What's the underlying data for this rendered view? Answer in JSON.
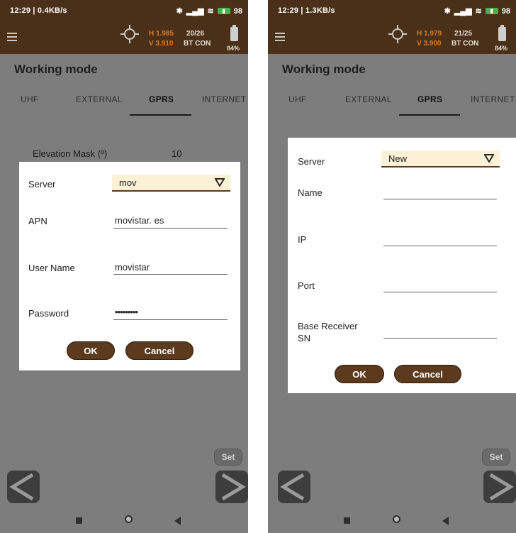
{
  "left": {
    "status": {
      "time": "12:29 | 0.4KB/s",
      "battery": "98"
    },
    "gps": {
      "h": "H 1.985",
      "v": "V 3.910",
      "sat": "20/26",
      "bt": "BT CON",
      "battery_pct": "84%"
    },
    "title": "Working mode",
    "tabs": [
      "UHF",
      "EXTERNAL",
      "GPRS",
      "INTERNET"
    ],
    "elevation": {
      "label": "Elevation Mask (º)",
      "value": "10"
    },
    "dialog": {
      "server_label": "Server",
      "server_value": "mov",
      "apn_label": "APN",
      "apn_value": "movistar. es",
      "user_label": "User Name",
      "user_value": "movistar",
      "password_label": "Password",
      "password_value": "•••••••••",
      "ok": "OK",
      "cancel": "Cancel"
    },
    "set": "Set"
  },
  "right": {
    "status": {
      "time": "12:29 | 1.3KB/s",
      "battery": "98"
    },
    "gps": {
      "h": "H 1.979",
      "v": "V 3.900",
      "sat": "21/25",
      "bt": "BT CON",
      "battery_pct": "84%"
    },
    "title": "Working mode",
    "tabs": [
      "UHF",
      "EXTERNAL",
      "GPRS",
      "INTERNET"
    ],
    "dialog": {
      "server_label": "Server",
      "server_value": "New",
      "name_label": "Name",
      "ip_label": "IP",
      "port_label": "Port",
      "base_label_1": "Base Receiver",
      "base_label_2": "SN",
      "ok": "OK",
      "cancel": "Cancel"
    },
    "set": "Set"
  },
  "colors": {
    "header": "#4a3018",
    "accent": "#5c3a1d",
    "select_bg": "#fbf1d6",
    "gps_value": "#d9792a"
  }
}
